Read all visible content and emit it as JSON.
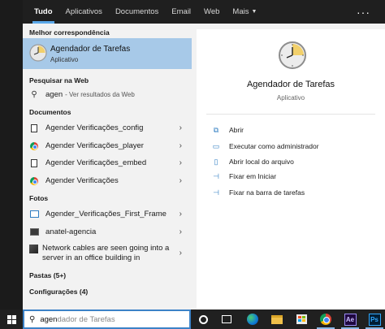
{
  "tabs": [
    {
      "label": "Tudo",
      "active": true
    },
    {
      "label": "Aplicativos"
    },
    {
      "label": "Documentos"
    },
    {
      "label": "Email"
    },
    {
      "label": "Web"
    },
    {
      "label": "Mais"
    }
  ],
  "more_menu_icon": "ellipsis-icon",
  "left": {
    "best_match_heading": "Melhor correspondência",
    "best_match": {
      "title": "Agendador de Tarefas",
      "subtitle": "Aplicativo",
      "icon": "task-scheduler-clock-icon"
    },
    "web_heading": "Pesquisar na Web",
    "web_item": {
      "query": "agen",
      "suffix": "- Ver resultados da Web"
    },
    "documents_heading": "Documentos",
    "documents": [
      {
        "label": "Agender Verificações_config",
        "icon": "document-icon"
      },
      {
        "label": "Agender Verificações_player",
        "icon": "chrome-icon"
      },
      {
        "label": "Agender Verificações_embed",
        "icon": "document-icon"
      },
      {
        "label": "Agender Verificações",
        "icon": "chrome-icon"
      }
    ],
    "photos_heading": "Fotos",
    "photos": [
      {
        "label": "Agender_Verificações_First_Frame",
        "icon": "image-icon"
      },
      {
        "label": "anatel-agencia",
        "icon": "photo-icon"
      }
    ],
    "photo_two_line": {
      "line1": "Network cables are seen going into a",
      "line2": "server in an office building in"
    },
    "folders_label": "Pastas (5+)",
    "settings_label": "Configurações (4)"
  },
  "right": {
    "title": "Agendador de Tarefas",
    "subtitle": "Aplicativo",
    "actions": [
      {
        "label": "Abrir",
        "icon": "open-icon"
      },
      {
        "label": "Executar como administrador",
        "icon": "run-as-admin-icon"
      },
      {
        "label": "Abrir local do arquivo",
        "icon": "file-location-icon"
      },
      {
        "label": "Fixar em Iniciar",
        "icon": "pin-start-icon"
      },
      {
        "label": "Fixar na barra de tarefas",
        "icon": "pin-taskbar-icon"
      }
    ]
  },
  "taskbar": {
    "search_typed": "agen",
    "search_ghost": "dador de Tarefas",
    "apps": [
      "cortana-icon",
      "task-view-icon",
      "edge-icon",
      "file-explorer-icon",
      "store-icon",
      "chrome-icon",
      "after-effects-icon",
      "photoshop-icon"
    ],
    "ae_label": "Ae",
    "ps_label": "Ps"
  },
  "colors": {
    "accent": "#5aa7e8",
    "selected": "#a7c9e8",
    "taskbar": "#202020"
  }
}
